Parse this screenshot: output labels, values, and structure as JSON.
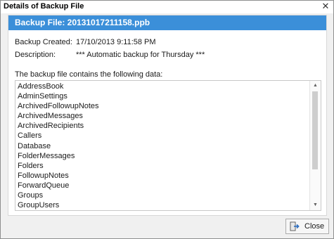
{
  "window": {
    "title": "Details of Backup File",
    "close_glyph": "✕"
  },
  "header": {
    "title": "Backup File: 20131017211158.ppb",
    "background_color": "#3b8fd9"
  },
  "details": {
    "created_label": "Backup Created:",
    "created_value": "17/10/2013 9:11:58 PM",
    "description_label": "Description:",
    "description_value": "*** Automatic backup for Thursday ***"
  },
  "data_section": {
    "label": "The backup file contains the following data:",
    "items": [
      "AddressBook",
      "AdminSettings",
      "ArchivedFollowupNotes",
      "ArchivedMessages",
      "ArchivedRecipients",
      "Callers",
      "Database",
      "FolderMessages",
      "Folders",
      "FollowupNotes",
      "ForwardQueue",
      "Groups",
      "GroupUsers"
    ],
    "scroll_up_glyph": "▲",
    "scroll_down_glyph": "▼"
  },
  "footer": {
    "close_label": "Close",
    "close_icon": "exit-icon"
  }
}
